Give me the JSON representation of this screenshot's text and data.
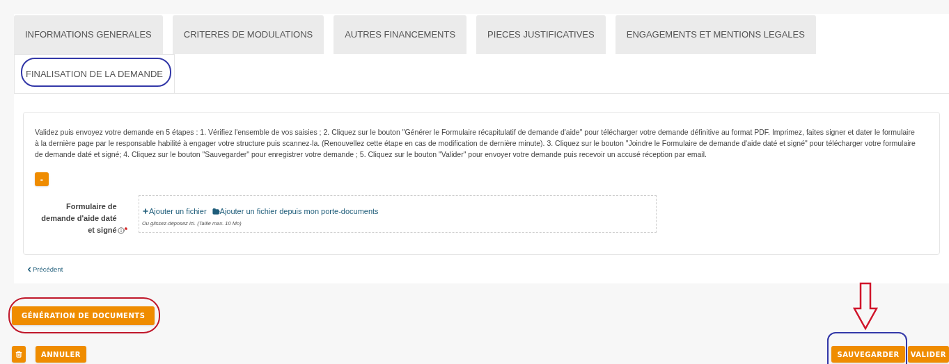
{
  "tabs": [
    {
      "label": "INFORMATIONS GENERALES",
      "selected": false
    },
    {
      "label": "CRITERES DE MODULATIONS",
      "selected": false
    },
    {
      "label": "AUTRES FINANCEMENTS",
      "selected": false
    },
    {
      "label": "PIECES JUSTIFICATIVES",
      "selected": false
    },
    {
      "label": "ENGAGEMENTS ET MENTIONS LEGALES",
      "selected": false
    },
    {
      "label": "FINALISATION DE LA DEMANDE",
      "selected": true
    }
  ],
  "instructions": "Validez puis envoyez votre demande en 5 étapes : 1. Vérifiez l'ensemble de vos saisies ; 2. Cliquez sur le bouton \"Générer le Formulaire récapitulatif de demande d'aide\" pour télécharger votre demande définitive au format PDF. Imprimez, faites signer et dater le formulaire à la dernière page par le responsable habilité à engager votre structure puis scannez-la. (Renouvellez cette étape en cas de modification de dernière minute). 3. Cliquez sur le bouton \"Joindre le Formulaire de demande d'aide daté et signé\" pour télécharger votre formulaire de demande daté et signé; 4. Cliquez sur le bouton \"Sauvegarder\" pour enregistrer votre demande ; 5. Cliquez sur le bouton \"Valider\" pour envoyer votre demande puis recevoir un accusé réception par email.",
  "collapse_button": "-",
  "upload": {
    "label": "Formulaire de demande d'aide daté et signé",
    "required_mark": "*",
    "add_file": "Ajouter un fichier",
    "add_from_documents": "Ajouter un fichier depuis mon porte-documents",
    "hint": "Ou glissez-déposez ici. (Taille max. 10 Mo)"
  },
  "previous_link": "Précédent",
  "generate_button": "GÉNÉRATION DE DOCUMENTS",
  "cancel_button": "ANNULER",
  "save_button": "SAUVEGARDER",
  "validate_button": "VALIDER"
}
